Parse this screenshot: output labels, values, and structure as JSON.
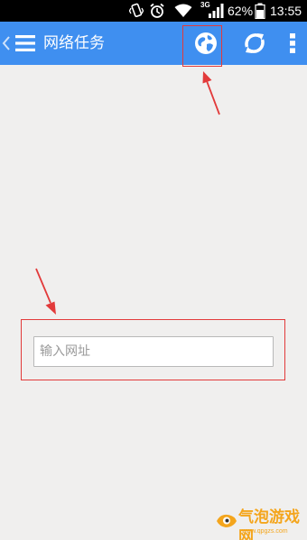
{
  "status_bar": {
    "network_label": "3G",
    "battery_percent": "62%",
    "time": "13:55",
    "icons": [
      "vibrate-icon",
      "alarm-icon",
      "wifi-icon",
      "signal-icon",
      "battery-icon"
    ]
  },
  "action_bar": {
    "title": "网络任务",
    "color": "#3f8ff0",
    "icons": [
      "back-caret-icon",
      "menu-icon",
      "globe-icon",
      "refresh-icon",
      "more-vert-icon"
    ]
  },
  "url_input": {
    "placeholder": "输入网址",
    "value": ""
  },
  "annotations": {
    "highlight_color": "#e23a3a"
  },
  "watermark": {
    "text": "气泡游戏网",
    "subtext": "www.qpgzs.com",
    "color": "#f4a51c"
  }
}
